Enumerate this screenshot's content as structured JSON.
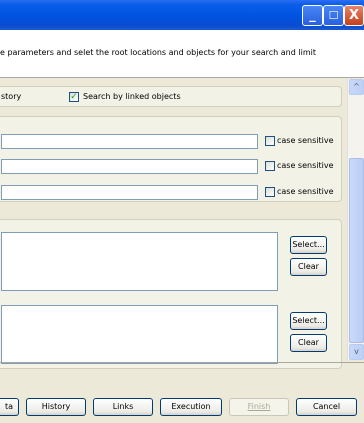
{
  "window": {
    "minimize_glyph": "_",
    "maximize_glyph": "☐",
    "close_glyph": "X"
  },
  "header": {
    "instruction": "e parameters and selet the root locations and objects for your search and limit"
  },
  "options": {
    "history_label": "story",
    "linked_checked_glyph": "✓",
    "linked_label": "Search by linked objects"
  },
  "fields": {
    "case_label": "case sensitive"
  },
  "lists": {
    "select_label": "Select...",
    "clear_label": "Clear"
  },
  "scrollbar": {
    "up_glyph": "^",
    "down_glyph": "v"
  },
  "footer": {
    "data_label": "ta",
    "history_label": "History",
    "links_label": "Links",
    "execution_label": "Execution",
    "finish_label": "Finish",
    "cancel_label": "Cancel"
  }
}
